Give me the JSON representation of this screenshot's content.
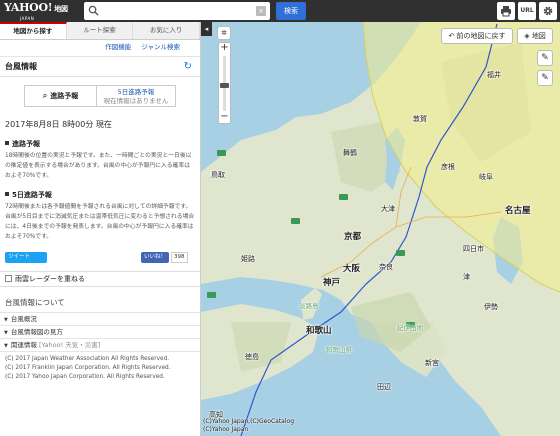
{
  "header": {
    "logo_text": "YAHOO!",
    "logo_suffix": "地図",
    "logo_sub": "JAPAN",
    "search_value": "",
    "search_placeholder": "",
    "search_button": "検索",
    "clear_symbol": "×",
    "url_button": "URL"
  },
  "tabs": [
    {
      "label": "地図から探す",
      "active": true
    },
    {
      "label": "ルート探索",
      "active": false
    },
    {
      "label": "お気に入り",
      "active": false
    }
  ],
  "subtools": {
    "tool1": "作図機能",
    "tool2": "ジャンル検索"
  },
  "typhoon": {
    "section_title": "台風情報",
    "forecast_label": "進路予報",
    "forecast_5day": "5日進路予報",
    "forecast_5day_note": "現在情報はありません",
    "date": "2017年8月8日 8時00分 現在",
    "heading1": "進路予報",
    "para1": "18時間後の位置の実況と予報です。また、一時間ごとの実況と一日後以の推定値を表示する場合があります。台風の中心が予報円に入る確率はおよそ70%です。",
    "heading2": "5日進路予報",
    "para2": "72時間後または各予報値間を予報される台風に対しての詳細予報です。台風が5日目までに消滅気圧または温帯低気圧に変わると予想される場合には、4日後までの予報を発表します。台風の中心が予報円に入る確率はおよそ70%です。",
    "tweet_label": "ツイート",
    "like_label": "いいね！",
    "like_count": "398"
  },
  "radar_toggle": "雨雲レーダーを重ねる",
  "about": {
    "title": "台風情報について",
    "items": [
      {
        "label": "台風概況",
        "source": ""
      },
      {
        "label": "台風情報図の見方",
        "source": ""
      },
      {
        "label": "関連情報",
        "source": "[Yahoo! 天気・災害]"
      }
    ]
  },
  "copyright": [
    "(C) 2017 Japan Weather Association All Rights Reserved.",
    "(C) 2017 Franklin Japan Corporation. All Rights Reserved.",
    "(C) 2017 Yahoo Japan Corporation. All Rights Reserved."
  ],
  "map": {
    "back_button": "前の地図に戻す",
    "layer_button": "地図",
    "labels": {
      "kyoto": "京都",
      "osaka": "大阪",
      "kobe": "神戸",
      "nara": "奈良",
      "nagoya": "名古屋",
      "gifu": "岐阜",
      "hikone": "彦根",
      "otsu": "大津",
      "tsu": "津",
      "yokkaichi": "四日市",
      "ise": "伊勢",
      "wakayama": "和歌山",
      "himeji": "姫路",
      "tottori": "鳥取",
      "maizuru": "舞鶴",
      "fukui": "福井",
      "tsuruga": "敦賀",
      "tanabe": "田辺",
      "shingu": "新宮",
      "tokushima": "徳島",
      "kochi": "高知",
      "awaji": "淡路島",
      "kii": "紀伊山地",
      "kinki": "和歌山県"
    },
    "attribution_1": "(C)Yahoo Japan,(C)GeoCatalog",
    "attribution_2": "(C)Yahoo Japan"
  },
  "colors": {
    "topbar": "#303030",
    "search_button": "#2e6fd8",
    "forecast_circle": "#f3ec8c",
    "track_line": "#3355cc",
    "sea": "#a8d0e4",
    "land": "#dfe6cd"
  },
  "icons": {
    "search": "search-icon",
    "print": "printer-icon",
    "settings": "gear-icon",
    "refresh": "refresh-icon",
    "pencil": "pencil-icon",
    "layers": "layers-icon"
  }
}
